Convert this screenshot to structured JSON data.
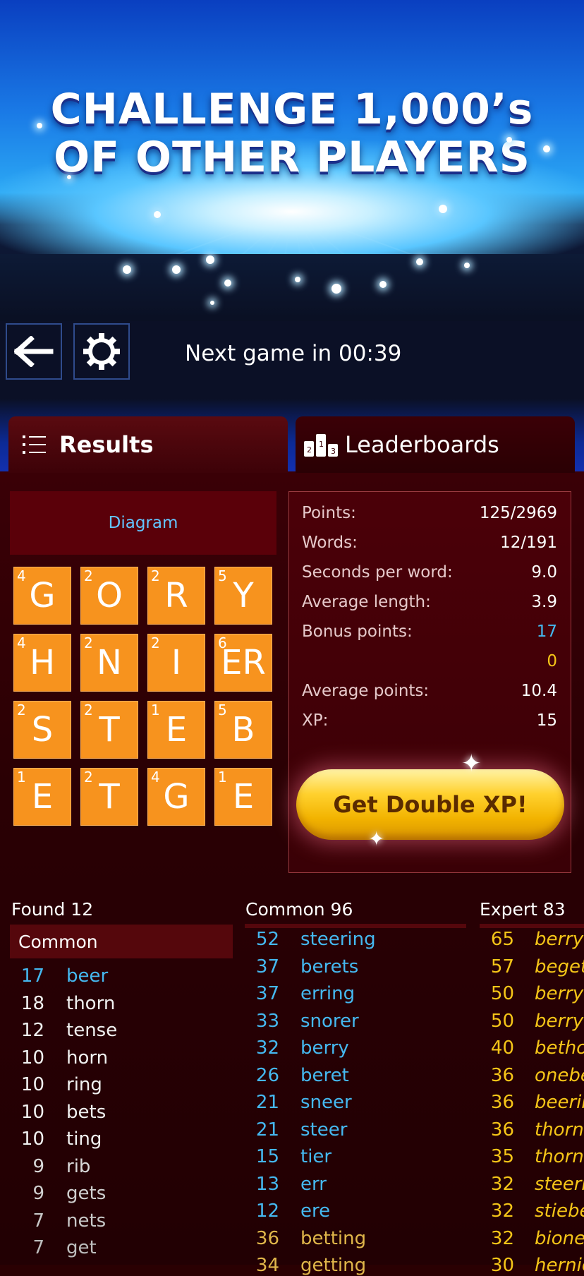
{
  "hero": {
    "line1": "CHALLENGE 1,000’s",
    "line2": "OF OTHER PLAYERS"
  },
  "topbar": {
    "back_icon": "back-arrow-icon",
    "settings_icon": "gear-icon",
    "next_game": "Next game in 00:39"
  },
  "tabs": [
    {
      "label": "Results",
      "icon": "list-icon"
    },
    {
      "label": "Leaderboards",
      "icon": "podium-icon"
    }
  ],
  "diagram_label": "Diagram",
  "board": [
    [
      {
        "letter": "G",
        "points": "4"
      },
      {
        "letter": "O",
        "points": "2"
      },
      {
        "letter": "R",
        "points": "2"
      },
      {
        "letter": "Y",
        "points": "5"
      }
    ],
    [
      {
        "letter": "H",
        "points": "4"
      },
      {
        "letter": "N",
        "points": "2"
      },
      {
        "letter": "I",
        "points": "2"
      },
      {
        "letter": "ER",
        "points": "6"
      }
    ],
    [
      {
        "letter": "S",
        "points": "2"
      },
      {
        "letter": "T",
        "points": "2"
      },
      {
        "letter": "E",
        "points": "1"
      },
      {
        "letter": "B",
        "points": "5"
      }
    ],
    [
      {
        "letter": "E",
        "points": "1"
      },
      {
        "letter": "T",
        "points": "2"
      },
      {
        "letter": "G",
        "points": "4"
      },
      {
        "letter": "E",
        "points": "1"
      }
    ]
  ],
  "stats": [
    {
      "label": "Points:",
      "value": "125/2969"
    },
    {
      "label": "Words:",
      "value": "12/191"
    },
    {
      "label": "Seconds per word:",
      "value": "9.0"
    },
    {
      "label": "Average length:",
      "value": "3.9"
    },
    {
      "label": "Bonus points:",
      "value": "17",
      "color": "#45b8f0"
    },
    {
      "label": "",
      "value": "0",
      "color": "#f5c518"
    },
    {
      "label": "Average points:",
      "value": "10.4"
    },
    {
      "label": "XP:",
      "value": "15"
    }
  ],
  "double_xp": "Get Double XP!",
  "found": {
    "header": "Found 12",
    "subheader": "Common",
    "rows": [
      {
        "n": "17",
        "w": "beer",
        "color": "#45b8f0"
      },
      {
        "n": "18",
        "w": "thorn",
        "color": "#f0f0f0"
      },
      {
        "n": "12",
        "w": "tense",
        "color": "#f0f0f0"
      },
      {
        "n": "10",
        "w": "horn",
        "color": "#f0f0f0"
      },
      {
        "n": "10",
        "w": "ring",
        "color": "#f0f0f0"
      },
      {
        "n": "10",
        "w": "bets",
        "color": "#f0f0f0"
      },
      {
        "n": "10",
        "w": "ting",
        "color": "#f0f0f0"
      },
      {
        "n": "9",
        "w": "rib",
        "color": "#d8d8d8"
      },
      {
        "n": "9",
        "w": "gets",
        "color": "#cfcfcf"
      },
      {
        "n": "7",
        "w": "nets",
        "color": "#c8c8c8"
      },
      {
        "n": "7",
        "w": "get",
        "color": "#bdbdbd"
      }
    ]
  },
  "common": {
    "header": "Common 96",
    "rows": [
      {
        "n": "52",
        "w": "steering",
        "color": "#45b8f0"
      },
      {
        "n": "37",
        "w": "berets",
        "color": "#45b8f0"
      },
      {
        "n": "37",
        "w": "erring",
        "color": "#45b8f0"
      },
      {
        "n": "33",
        "w": "snorer",
        "color": "#45b8f0"
      },
      {
        "n": "32",
        "w": "berry",
        "color": "#45b8f0"
      },
      {
        "n": "26",
        "w": "beret",
        "color": "#45b8f0"
      },
      {
        "n": "21",
        "w": "sneer",
        "color": "#45b8f0"
      },
      {
        "n": "21",
        "w": "steer",
        "color": "#45b8f0"
      },
      {
        "n": "15",
        "w": "tier",
        "color": "#45b8f0"
      },
      {
        "n": "13",
        "w": "err",
        "color": "#45b8f0"
      },
      {
        "n": "12",
        "w": "ere",
        "color": "#45b8f0"
      },
      {
        "n": "36",
        "w": "betting",
        "color": "#e0b64a"
      },
      {
        "n": "34",
        "w": "getting",
        "color": "#e0b64a"
      }
    ]
  },
  "expert": {
    "header": "Expert 83",
    "rows": [
      {
        "n": "65",
        "w": "berry"
      },
      {
        "n": "57",
        "w": "beget"
      },
      {
        "n": "50",
        "w": "berry"
      },
      {
        "n": "50",
        "w": "berry"
      },
      {
        "n": "40",
        "w": "betho"
      },
      {
        "n": "36",
        "w": "onebe"
      },
      {
        "n": "36",
        "w": "beerin"
      },
      {
        "n": "36",
        "w": "thorn"
      },
      {
        "n": "35",
        "w": "thorn"
      },
      {
        "n": "32",
        "w": "steeri"
      },
      {
        "n": "32",
        "w": "stiebe"
      },
      {
        "n": "32",
        "w": "bione"
      },
      {
        "n": "30",
        "w": "hernio"
      }
    ]
  },
  "colors": {
    "tile": "#f7931e",
    "panel": "#3a0006",
    "accent_blue": "#45b8f0",
    "gold": "#f5c518"
  }
}
